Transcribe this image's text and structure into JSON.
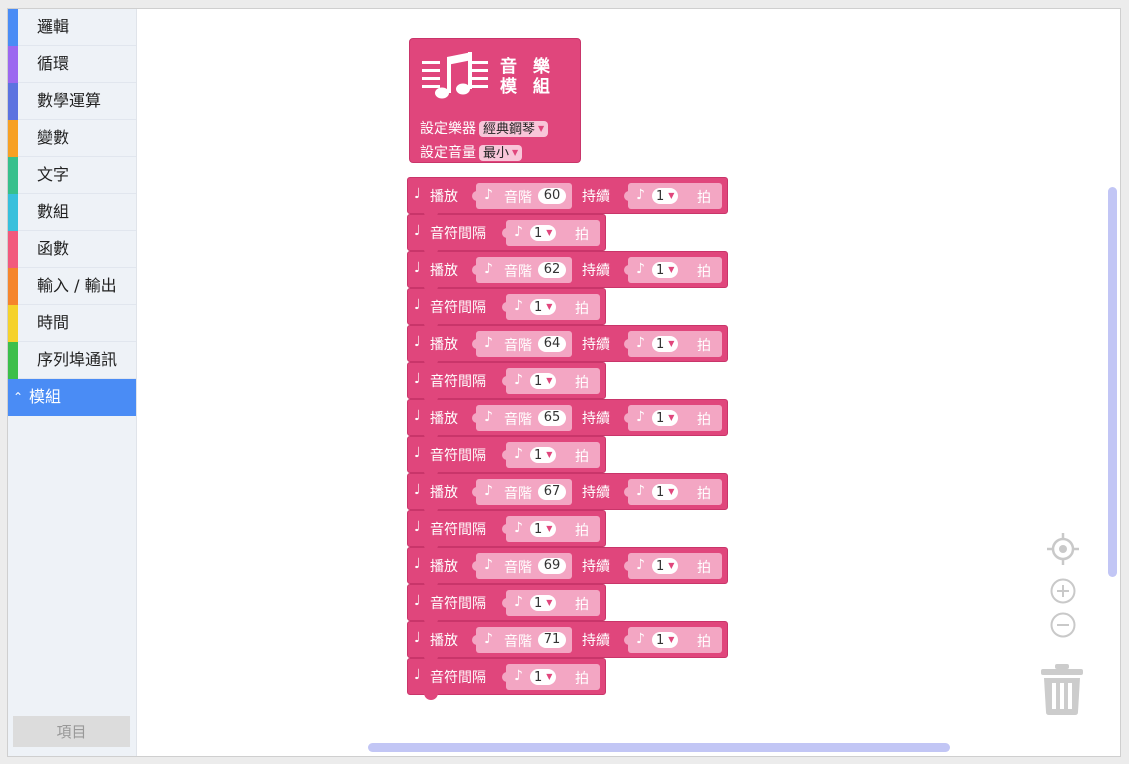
{
  "sidebar": {
    "categories": [
      {
        "label": "邏輯",
        "color": "#4a8cf5"
      },
      {
        "label": "循環",
        "color": "#9c68f0"
      },
      {
        "label": "數學運算",
        "color": "#5c73e0"
      },
      {
        "label": "變數",
        "color": "#f7a023"
      },
      {
        "label": "文字",
        "color": "#37c08c"
      },
      {
        "label": "數組",
        "color": "#38c0dc"
      },
      {
        "label": "函數",
        "color": "#f25a7d"
      },
      {
        "label": "輸入 / 輸出",
        "color": "#f5852b"
      },
      {
        "label": "時間",
        "color": "#f5d22a"
      },
      {
        "label": "序列埠通訊",
        "color": "#3dbf4a"
      },
      {
        "label": "模組",
        "color": "#4a8cf5",
        "active": true
      }
    ],
    "project_button": "項目"
  },
  "music_block": {
    "title_line1": "音 樂",
    "title_line2": "模 組",
    "instrument_label": "設定樂器",
    "instrument_value": "經典鋼琴",
    "volume_label": "設定音量",
    "volume_value": "最小",
    "color": "#e0467c"
  },
  "blocks": [
    {
      "type": "play",
      "label": "播放",
      "pitch_label": "音階",
      "pitch": "60",
      "duration_label": "持續",
      "beats": "1",
      "beat_unit": "拍"
    },
    {
      "type": "rest",
      "label": "音符間隔",
      "beats": "1",
      "beat_unit": "拍"
    },
    {
      "type": "play",
      "label": "播放",
      "pitch_label": "音階",
      "pitch": "62",
      "duration_label": "持續",
      "beats": "1",
      "beat_unit": "拍"
    },
    {
      "type": "rest",
      "label": "音符間隔",
      "beats": "1",
      "beat_unit": "拍"
    },
    {
      "type": "play",
      "label": "播放",
      "pitch_label": "音階",
      "pitch": "64",
      "duration_label": "持續",
      "beats": "1",
      "beat_unit": "拍"
    },
    {
      "type": "rest",
      "label": "音符間隔",
      "beats": "1",
      "beat_unit": "拍"
    },
    {
      "type": "play",
      "label": "播放",
      "pitch_label": "音階",
      "pitch": "65",
      "duration_label": "持續",
      "beats": "1",
      "beat_unit": "拍"
    },
    {
      "type": "rest",
      "label": "音符間隔",
      "beats": "1",
      "beat_unit": "拍"
    },
    {
      "type": "play",
      "label": "播放",
      "pitch_label": "音階",
      "pitch": "67",
      "duration_label": "持續",
      "beats": "1",
      "beat_unit": "拍"
    },
    {
      "type": "rest",
      "label": "音符間隔",
      "beats": "1",
      "beat_unit": "拍"
    },
    {
      "type": "play",
      "label": "播放",
      "pitch_label": "音階",
      "pitch": "69",
      "duration_label": "持續",
      "beats": "1",
      "beat_unit": "拍"
    },
    {
      "type": "rest",
      "label": "音符間隔",
      "beats": "1",
      "beat_unit": "拍"
    },
    {
      "type": "play",
      "label": "播放",
      "pitch_label": "音階",
      "pitch": "71",
      "duration_label": "持續",
      "beats": "1",
      "beat_unit": "拍"
    },
    {
      "type": "rest",
      "label": "音符間隔",
      "beats": "1",
      "beat_unit": "拍"
    }
  ],
  "icons": {
    "note_glyph": "♩",
    "slot_note_glyph": "♪",
    "recenter": "crosshair-icon",
    "zoom_in": "zoom-in-icon",
    "zoom_out": "zoom-out-icon",
    "trash": "trash-icon"
  }
}
